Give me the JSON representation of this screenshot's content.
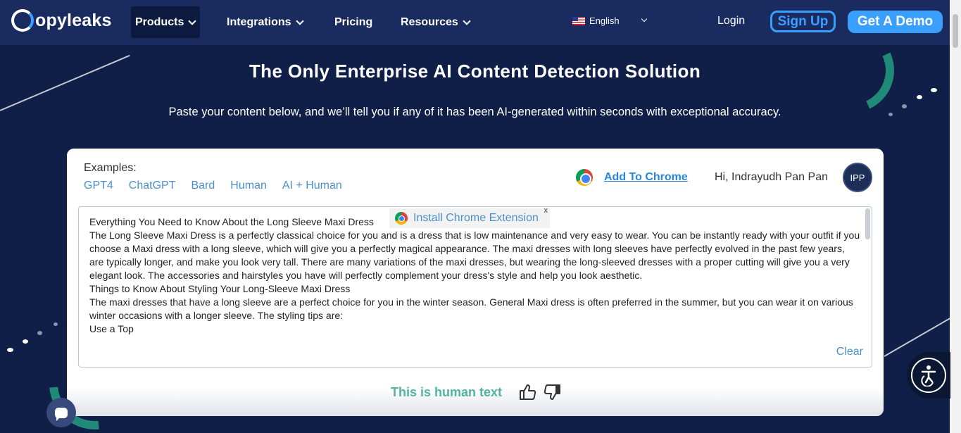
{
  "nav": {
    "logo_text": "opyleaks",
    "items": [
      {
        "label": "Products",
        "active": true,
        "dropdown": true
      },
      {
        "label": "Integrations",
        "active": false,
        "dropdown": true
      },
      {
        "label": "Pricing",
        "active": false,
        "dropdown": false
      },
      {
        "label": "Resources",
        "active": false,
        "dropdown": true
      }
    ],
    "language": "English",
    "login": "Login",
    "signup": "Sign Up",
    "demo": "Get A Demo"
  },
  "hero": {
    "title": "The Only Enterprise AI Content Detection Solution",
    "subtitle": "Paste your content below, and we’ll tell you if any of it has been AI-generated within seconds with exceptional accuracy."
  },
  "card": {
    "examples_label": "Examples:",
    "examples": [
      "GPT4",
      "ChatGPT",
      "Bard",
      "Human",
      "AI + Human"
    ],
    "add_to_chrome": "Add To Chrome",
    "greeting": "Hi, Indrayudh Pan Pan",
    "avatar": "IPP",
    "text_lines": [
      "Everything You Need to Know About the Long Sleeve Maxi Dress",
      "The Long Sleeve Maxi Dress is a perfectly classical choice for you and is a dress that is low maintenance and very easy to wear. You can be instantly ready with your outfit if you choose a Maxi dress with a long sleeve, which will give you a perfectly magical appearance. The maxi dresses with long sleeves have perfectly evolved in the past few years, are typically longer, and make you look very tall. There are many variations of the maxi dresses, but wearing the long-sleeved dresses with a proper cutting will give you a very elegant look. The accessories and hairstyles you have will perfectly complement your dress's style and help you look aesthetic.",
      "Things to Know About Styling Your Long-Sleeve Maxi Dress",
      "The maxi dresses that have a long sleeve are a perfect choice for you in the winter season. General Maxi dress is often preferred in the summer, but you can wear it on various winter occasions with a longer sleeve. The styling tips are:",
      "Use a Top"
    ],
    "clear": "Clear",
    "extension_popup": "Install Chrome Extension",
    "extension_close": "x",
    "result": "This is human text"
  },
  "colors": {
    "nav_bg": "#1a2b5f",
    "page_bg": "#0f1f47",
    "accent": "#3aa0ff",
    "result": "#4fb5a0"
  },
  "icons": [
    "chrome-icon",
    "thumbs-up-icon",
    "thumbs-down-icon",
    "chat-icon",
    "accessibility-icon",
    "chevron-down-icon",
    "us-flag-icon"
  ]
}
